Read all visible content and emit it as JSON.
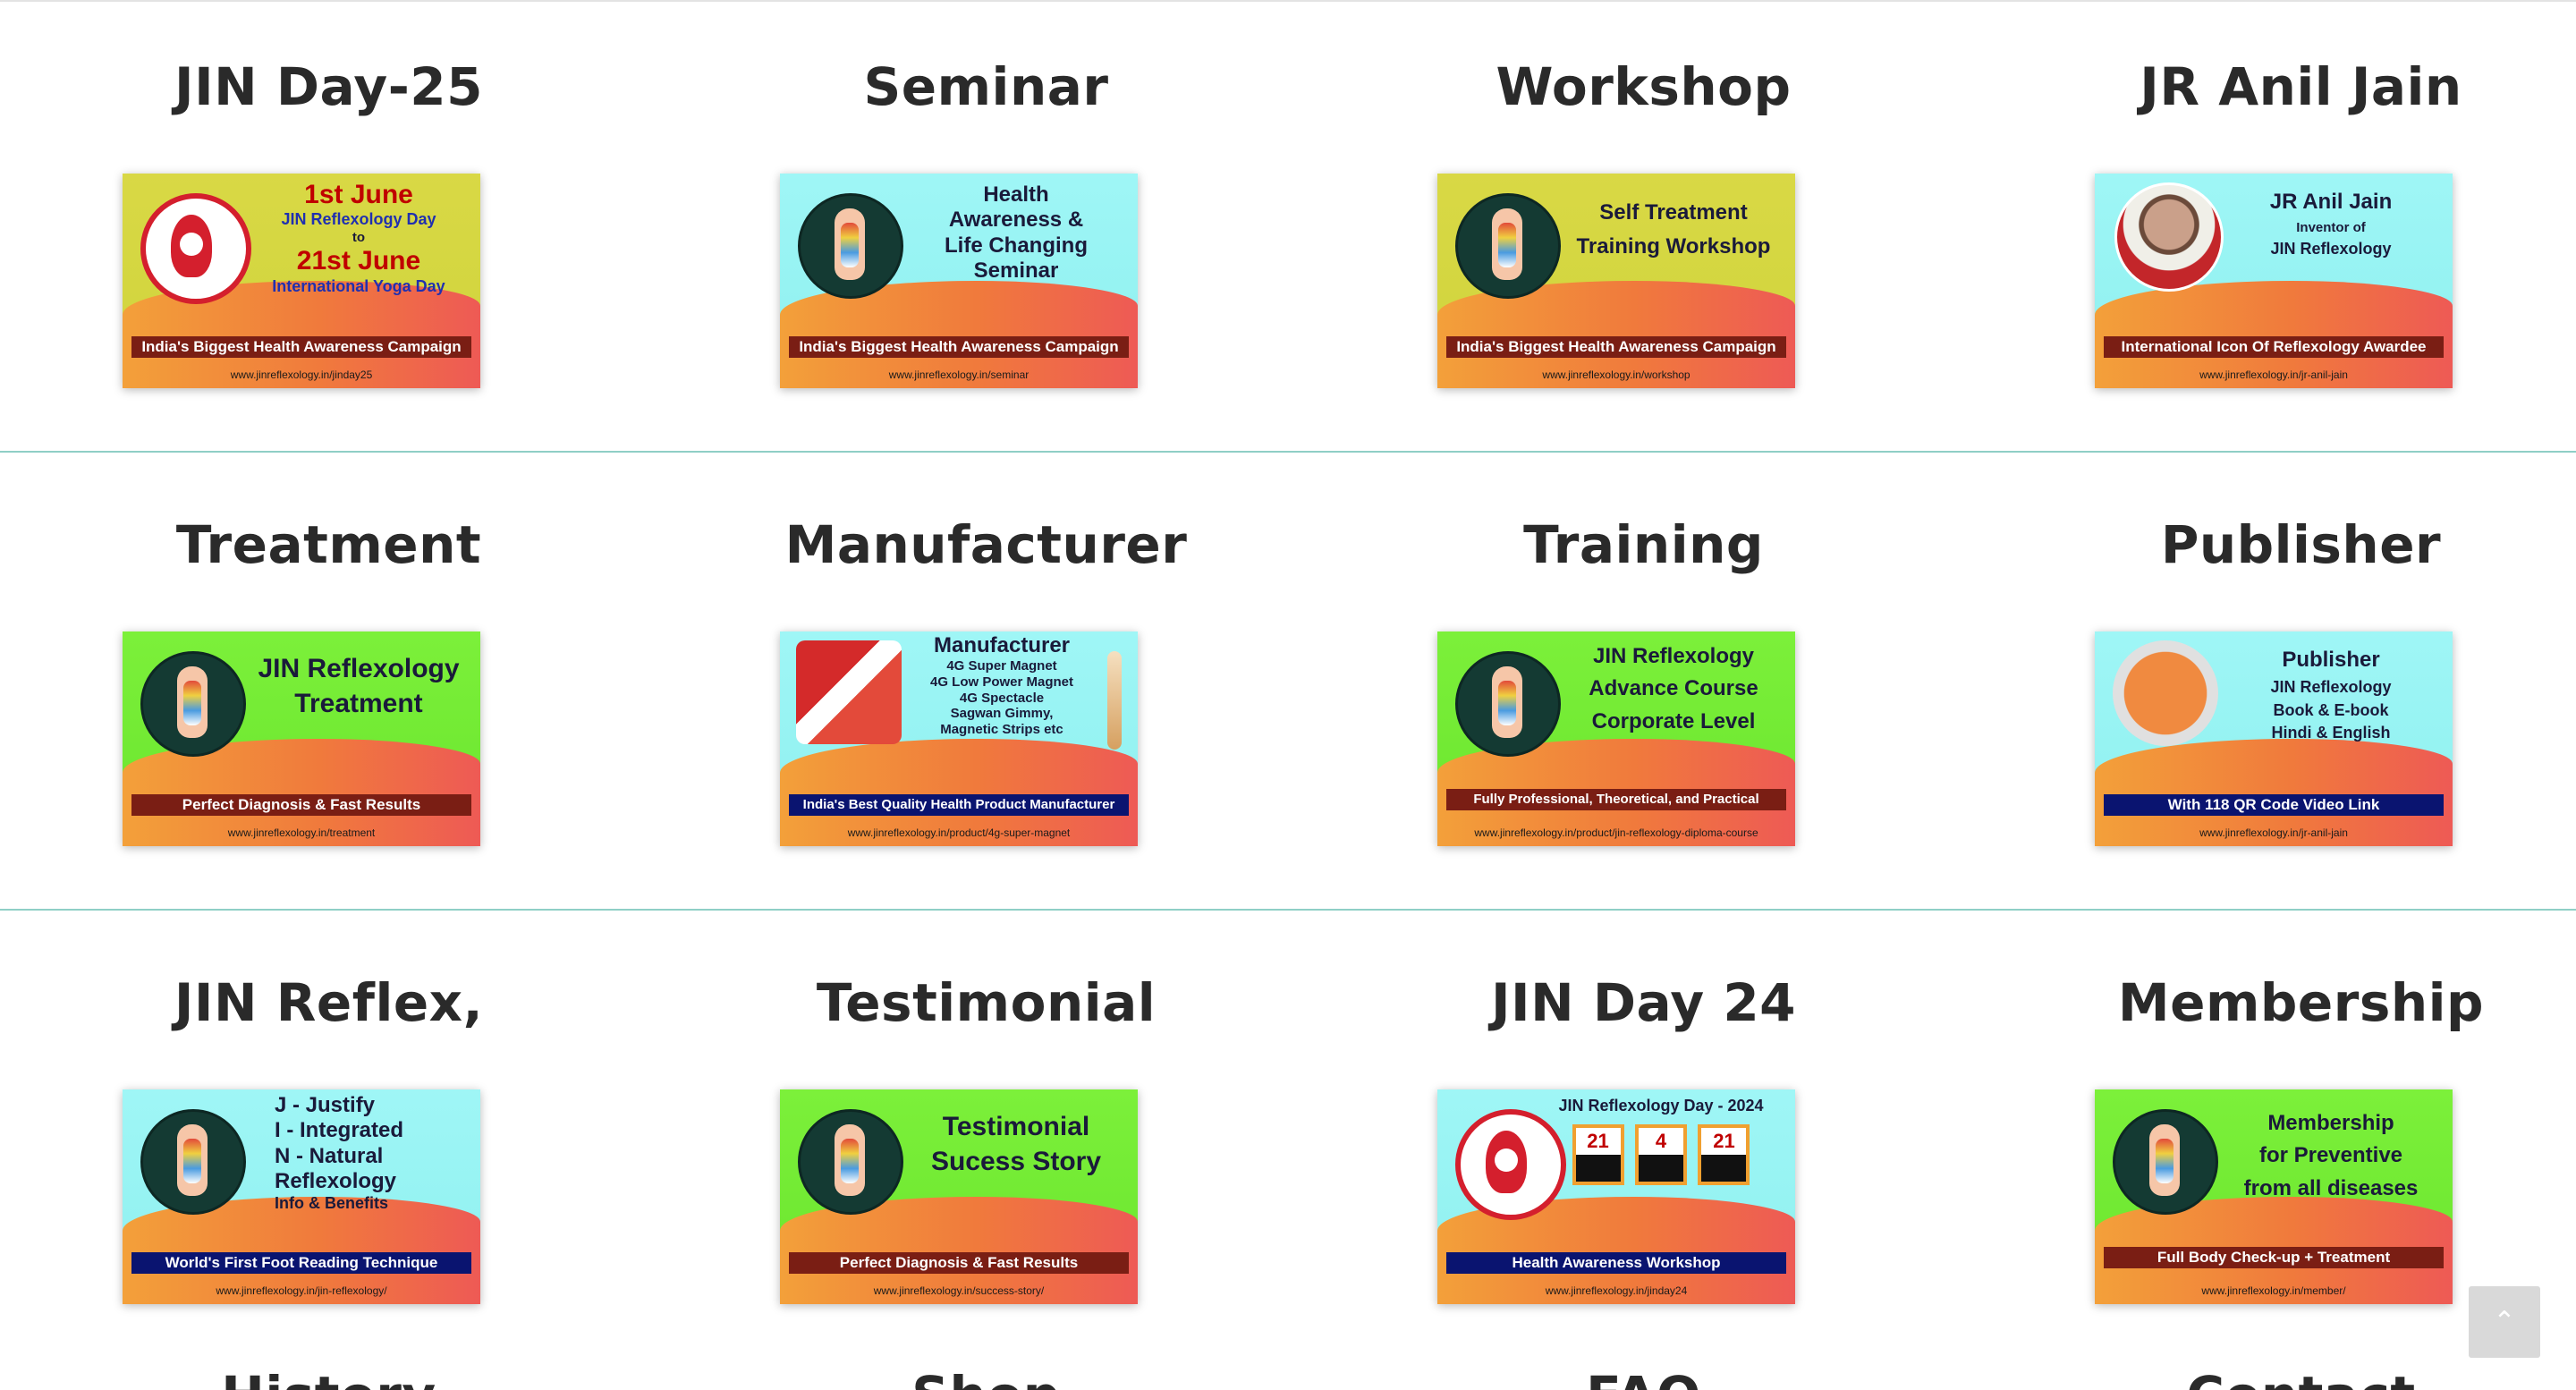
{
  "rows": [
    {
      "cells": [
        {
          "title": "JIN Day-25",
          "card": {
            "lines": [
              "1st June",
              "JIN Reflexology Day",
              "to",
              "21st June",
              "International Yoga Day"
            ],
            "bar": "India's Biggest Health Awareness Campaign",
            "url": "www.jinreflexology.in/jinday25"
          }
        },
        {
          "title": "Seminar",
          "card": {
            "lines": [
              "Health",
              "Awareness &",
              "Life Changing",
              "Seminar"
            ],
            "bar": "India's Biggest Health Awareness Campaign",
            "url": "www.jinreflexology.in/seminar"
          }
        },
        {
          "title": "Workshop",
          "card": {
            "lines": [
              "Self Treatment",
              "Training Workshop"
            ],
            "bar": "India's Biggest Health Awareness Campaign",
            "url": "www.jinreflexology.in/workshop"
          }
        },
        {
          "title": "JR Anil Jain",
          "card": {
            "lines": [
              "JR Anil Jain",
              "Inventor of",
              "JIN Reflexology"
            ],
            "bar": "International Icon Of Reflexology Awardee",
            "url": "www.jinreflexology.in/jr-anil-jain"
          }
        }
      ]
    },
    {
      "cells": [
        {
          "title": "Treatment",
          "card": {
            "lines": [
              "JIN Reflexology",
              "Treatment"
            ],
            "bar": "Perfect Diagnosis  & Fast Results",
            "url": "www.jinreflexology.in/treatment"
          }
        },
        {
          "title": "Manufacturer",
          "card": {
            "lines": [
              "Manufacturer",
              "4G Super Magnet",
              "4G Low Power Magnet",
              "4G Spectacle",
              "Sagwan Gimmy,",
              "Magnetic Strips etc"
            ],
            "bar": "India's Best Quality Health Product Manufacturer",
            "url": "www.jinreflexology.in/product/4g-super-magnet"
          }
        },
        {
          "title": "Training",
          "card": {
            "lines": [
              "JIN Reflexology",
              "Advance Course",
              "Corporate Level"
            ],
            "bar": "Fully Professional, Theoretical, and Practical",
            "url": "www.jinreflexology.in/product/jin-reflexology-diploma-course"
          }
        },
        {
          "title": "Publisher",
          "card": {
            "lines": [
              "Publisher",
              "JIN Reflexology",
              "Book & E-book",
              "Hindi & English"
            ],
            "bar": "With 118 QR Code Video Link",
            "url": "www.jinreflexology.in/jr-anil-jain"
          }
        }
      ]
    },
    {
      "cells": [
        {
          "title": "JIN Reflex,",
          "card": {
            "lines": [
              "J - Justify",
              "I - Integrated",
              "N - Natural",
              "Reflexology",
              "Info & Benefits"
            ],
            "bar": "World's First Foot Reading Technique",
            "url": "www.jinreflexology.in/jin-reflexology/"
          }
        },
        {
          "title": "Testimonial",
          "card": {
            "lines": [
              "Testimonial",
              "Sucess Story"
            ],
            "bar": "Perfect Diagnosis  & Fast Results",
            "url": "www.jinreflexology.in/success-story/"
          }
        },
        {
          "title": "JIN Day 24",
          "card": {
            "lines": [
              "JIN Reflexology Day - 2024"
            ],
            "days": [
              "21",
              "4",
              "21"
            ],
            "bar": "Health Awareness Workshop",
            "url": "www.jinreflexology.in/jinday24"
          }
        },
        {
          "title": "Membership",
          "card": {
            "lines": [
              "Membership",
              "for Preventive",
              "from all diseases"
            ],
            "bar": "Full Body Check-up + Treatment",
            "url": "www.jinreflexology.in/member/"
          }
        }
      ]
    },
    {
      "cells": [
        {
          "title": "History"
        },
        {
          "title": "Shop"
        },
        {
          "title": "FAQ"
        },
        {
          "title": "Contact"
        }
      ]
    }
  ],
  "scroll_top": {
    "icon": "chevron-up-icon",
    "label": "⌃"
  }
}
